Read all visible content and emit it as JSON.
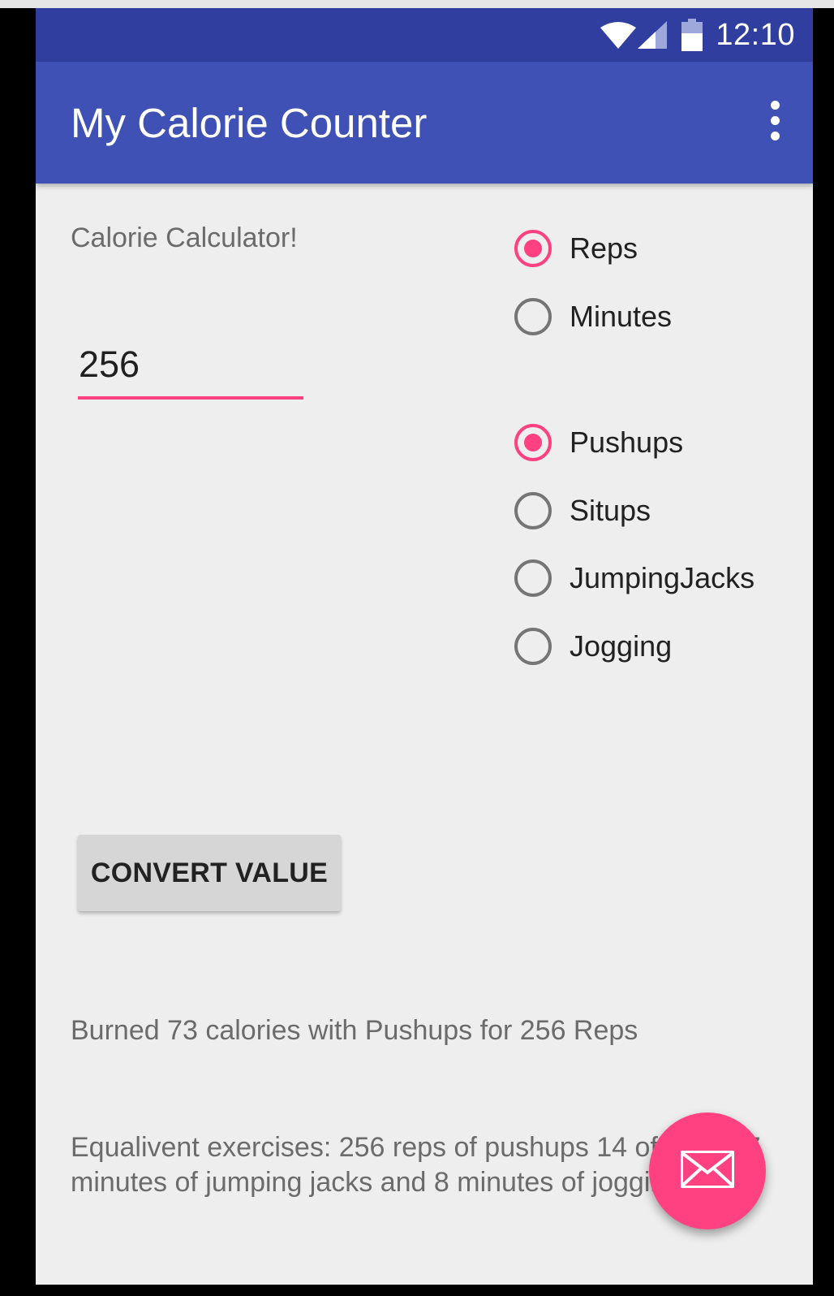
{
  "status_bar": {
    "time": "12:10",
    "icons": [
      "wifi-icon",
      "signal-icon",
      "battery-icon"
    ]
  },
  "app_bar": {
    "title": "My Calorie Counter",
    "menu_icon": "more-vert-icon"
  },
  "main": {
    "subtitle": "Calorie Calculator!",
    "amount_value": "256",
    "unit_options": [
      {
        "label": "Reps",
        "checked": true
      },
      {
        "label": "Minutes",
        "checked": false
      }
    ],
    "exercise_options": [
      {
        "label": "Pushups",
        "checked": true
      },
      {
        "label": "Situps",
        "checked": false
      },
      {
        "label": "JumpingJacks",
        "checked": false
      },
      {
        "label": "Jogging",
        "checked": false
      }
    ],
    "convert_button": "CONVERT VALUE",
    "result": "Burned 73 calories with Pushups for 256 Reps",
    "equivalents": "Equalivent exercises: 256 reps of pushups 14 of situps 7 minutes of jumping jacks and 8 minutes of jogging."
  },
  "fab": {
    "icon": "mail-icon"
  },
  "colors": {
    "primary": "#3f51b5",
    "primary_dark": "#303f9f",
    "accent": "#ff4081",
    "background": "#eeeeee"
  }
}
